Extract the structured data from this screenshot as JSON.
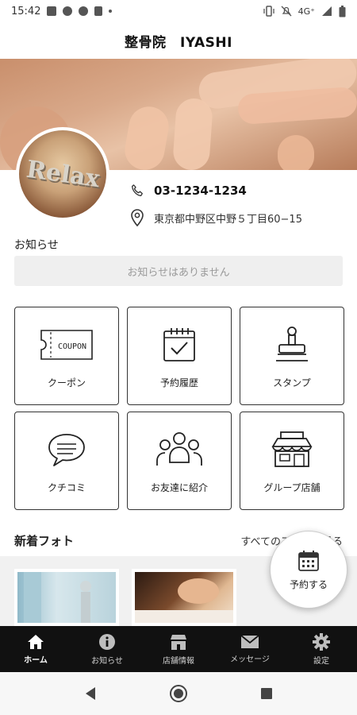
{
  "status_bar": {
    "time": "15:42",
    "network": "4G⁺"
  },
  "header": {
    "title": "整骨院　IYASHI"
  },
  "hero": {
    "avatar_text": "Relax"
  },
  "contact": {
    "phone": "03-1234-1234",
    "address": "東京都中野区中野５丁目60−15"
  },
  "news": {
    "label": "お知らせ",
    "empty_message": "お知らせはありません"
  },
  "menu_tiles": [
    {
      "label": "クーポン",
      "icon": "coupon-icon",
      "icon_text": "COUPON"
    },
    {
      "label": "予約履歴",
      "icon": "calendar-check-icon"
    },
    {
      "label": "スタンプ",
      "icon": "stamp-icon"
    },
    {
      "label": "クチコミ",
      "icon": "speech-bubble-icon"
    },
    {
      "label": "お友達に紹介",
      "icon": "friends-icon"
    },
    {
      "label": "グループ店舗",
      "icon": "store-icon"
    }
  ],
  "photos": {
    "title": "新着フォト",
    "see_all": "すべてのフォトを見る"
  },
  "reserve_button": {
    "label": "予約する"
  },
  "bottom_nav": [
    {
      "label": "ホーム",
      "icon": "home-icon",
      "active": true
    },
    {
      "label": "お知らせ",
      "icon": "info-icon",
      "active": false
    },
    {
      "label": "店舗情報",
      "icon": "store-icon",
      "active": false
    },
    {
      "label": "メッセージ",
      "icon": "mail-icon",
      "active": false
    },
    {
      "label": "設定",
      "icon": "gear-icon",
      "active": false
    }
  ],
  "colors": {
    "nav_bg": "#111111",
    "tile_border": "#333333",
    "news_bg": "#efefef"
  }
}
